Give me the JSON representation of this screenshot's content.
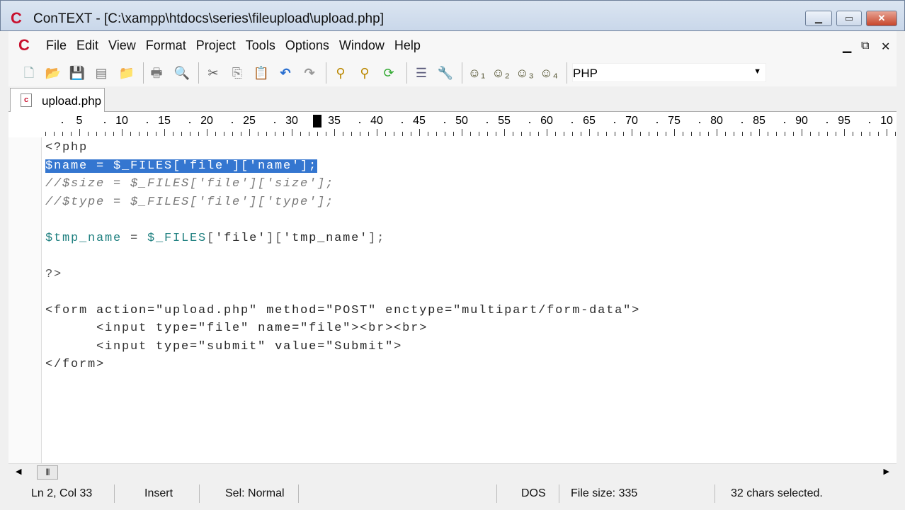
{
  "window": {
    "title": "ConTEXT - [C:\\xampp\\htdocs\\series\\fileupload\\upload.php]",
    "app_icon": "C"
  },
  "menu": [
    "File",
    "Edit",
    "View",
    "Format",
    "Project",
    "Tools",
    "Options",
    "Window",
    "Help"
  ],
  "toolbar": {
    "language": "PHP",
    "icons": [
      "new-file",
      "open",
      "save",
      "save-all",
      "open-folder",
      "print",
      "print-preview",
      "cut",
      "copy",
      "paste",
      "undo",
      "redo",
      "find",
      "find-next",
      "replace",
      "format",
      "tools",
      "user-command-1",
      "user-command-2",
      "user-command-3",
      "user-command-4"
    ]
  },
  "tabs": [
    {
      "label": "upload.php",
      "active": true
    }
  ],
  "ruler": {
    "labels": [
      "5",
      "10",
      "15",
      "20",
      "25",
      "30",
      "35",
      "40",
      "45",
      "50",
      "55",
      "60",
      "65",
      "70",
      "75",
      "80",
      "85",
      "90",
      "95",
      "10"
    ],
    "cursor_col": 33
  },
  "code": [
    [
      [
        "tag",
        "<?php"
      ]
    ],
    [
      [
        "sel",
        "$name = $_FILES['file']['name'];"
      ]
    ],
    [
      [
        "cmt",
        "//$size = $_FILES['file']['size'];"
      ]
    ],
    [
      [
        "cmt",
        "//$type = $_FILES['file']['type'];"
      ]
    ],
    [],
    [
      [
        "var",
        "$tmp_name"
      ],
      [
        "punc",
        " = "
      ],
      [
        "var",
        "$_FILES"
      ],
      [
        "punc",
        "["
      ],
      [
        "str",
        "'file'"
      ],
      [
        "punc",
        "]["
      ],
      [
        "str",
        "'tmp_name'"
      ],
      [
        "punc",
        "];"
      ]
    ],
    [],
    [
      [
        "punc",
        "?>"
      ]
    ],
    [],
    [
      [
        "tag",
        "<form "
      ],
      [
        "attr",
        "action="
      ],
      [
        "str",
        "\"upload.php\""
      ],
      [
        "attr",
        " method="
      ],
      [
        "str",
        "\"POST\""
      ],
      [
        "attr",
        " enctype="
      ],
      [
        "str",
        "\"multipart/form-data\""
      ],
      [
        "tag",
        ">"
      ]
    ],
    [
      [
        "tag",
        "      <input "
      ],
      [
        "attr",
        "type="
      ],
      [
        "str",
        "\"file\""
      ],
      [
        "attr",
        " name="
      ],
      [
        "str",
        "\"file\""
      ],
      [
        "tag",
        "><br><br>"
      ]
    ],
    [
      [
        "tag",
        "      <input "
      ],
      [
        "attr",
        "type="
      ],
      [
        "str",
        "\"submit\""
      ],
      [
        "attr",
        " value="
      ],
      [
        "str",
        "\"Submit\""
      ],
      [
        "tag",
        ">"
      ]
    ],
    [
      [
        "tag",
        "</form>"
      ]
    ]
  ],
  "status": {
    "position": "Ln 2, Col 33",
    "mode": "Insert",
    "sel": "Sel: Normal",
    "blank": "",
    "eol": "DOS",
    "file_size": "File size: 335",
    "selection": "32 chars selected."
  }
}
